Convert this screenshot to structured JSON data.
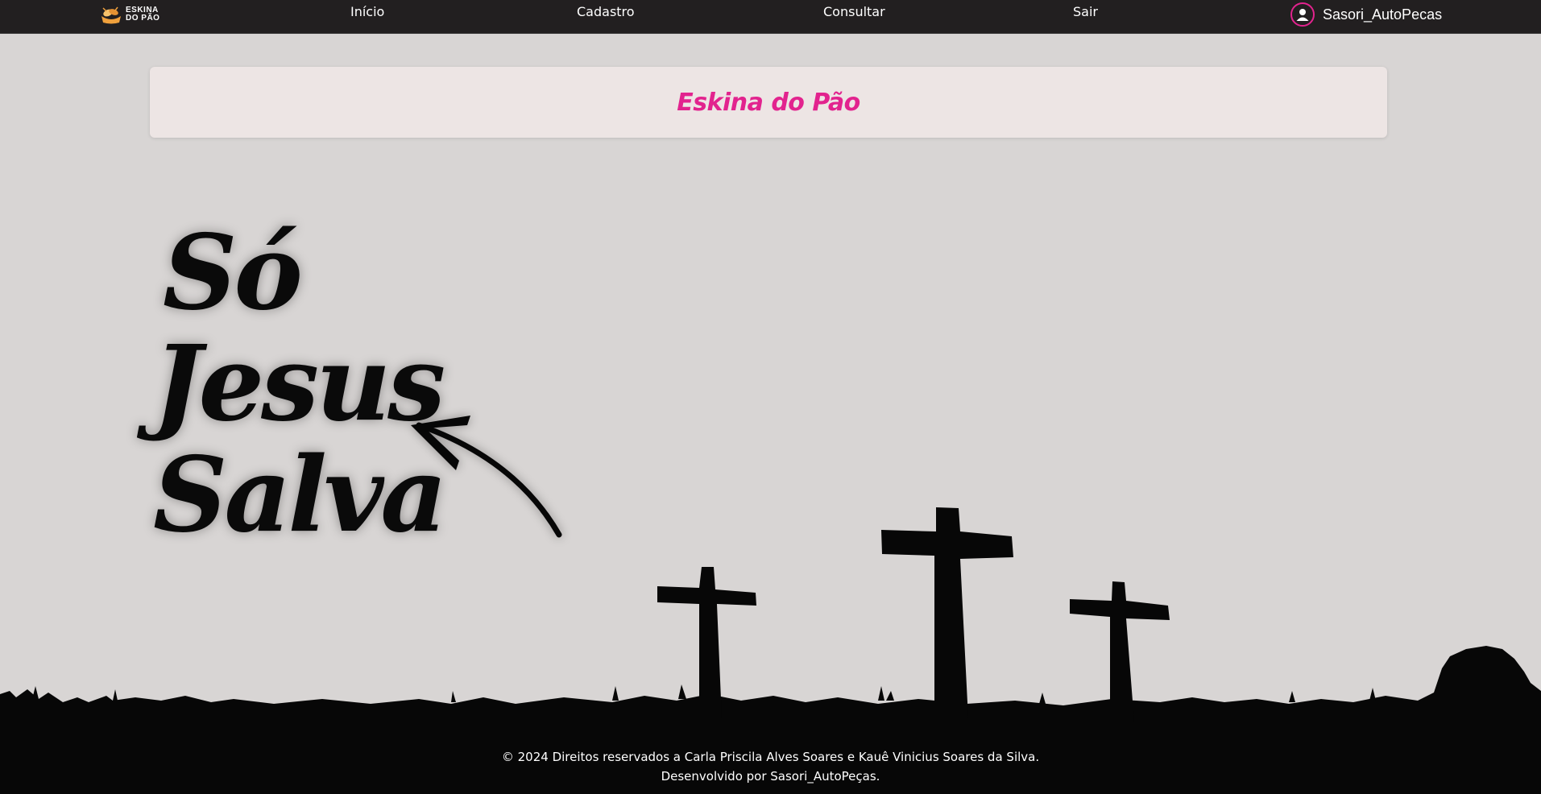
{
  "nav": {
    "logo_line1": "ESKINA",
    "logo_line2": "DO PÃO",
    "links": {
      "inicio": "Início",
      "cadastro": "Cadastro",
      "consultar": "Consultar",
      "sair": "Sair"
    },
    "username": "Sasori_AutoPecas",
    "avatar_icon": "user-circle-icon"
  },
  "title_card": {
    "title": "Eskina do Pão"
  },
  "hero": {
    "line1": "Só",
    "line2": "Jesus",
    "line3": "Salva",
    "arrow_icon": "curved-arrow-icon"
  },
  "footer": {
    "copyright": "© 2024 Direitos reservados a Carla Priscila Alves Soares e Kauê Vinicius Soares da Silva.",
    "developer": "Desenvolvido por Sasori_AutoPeças."
  },
  "colors": {
    "accent": "#e2238e",
    "navbar_bg": "#221f20",
    "page_bg": "#d8d5d4",
    "card_bg": "#ede5e4",
    "silhouette": "#070707"
  }
}
